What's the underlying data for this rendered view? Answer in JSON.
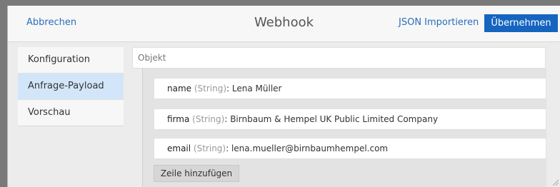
{
  "header": {
    "cancel_label": "Abbrechen",
    "title": "Webhook",
    "import_label": "JSON Importieren",
    "apply_label": "Übernehmen"
  },
  "sidebar": {
    "items": [
      {
        "label": "Konfiguration",
        "active": false
      },
      {
        "label": "Anfrage-Payload",
        "active": true
      },
      {
        "label": "Vorschau",
        "active": false
      }
    ]
  },
  "payload": {
    "root_label": "Objekt",
    "fields": [
      {
        "name": "name",
        "type": "(String)",
        "value": "Lena Müller"
      },
      {
        "name": "firma",
        "type": "(String)",
        "value": "Birnbaum & Hempel UK Public Limited Company"
      },
      {
        "name": "email",
        "type": "(String)",
        "value": "lena.mueller@birnbaumhempel.com"
      }
    ],
    "add_row_label": "Zeile hinzufügen"
  },
  "colors": {
    "accent": "#1565c0",
    "link": "#2a6ebb",
    "active_item_bg": "#d3e6f9"
  }
}
